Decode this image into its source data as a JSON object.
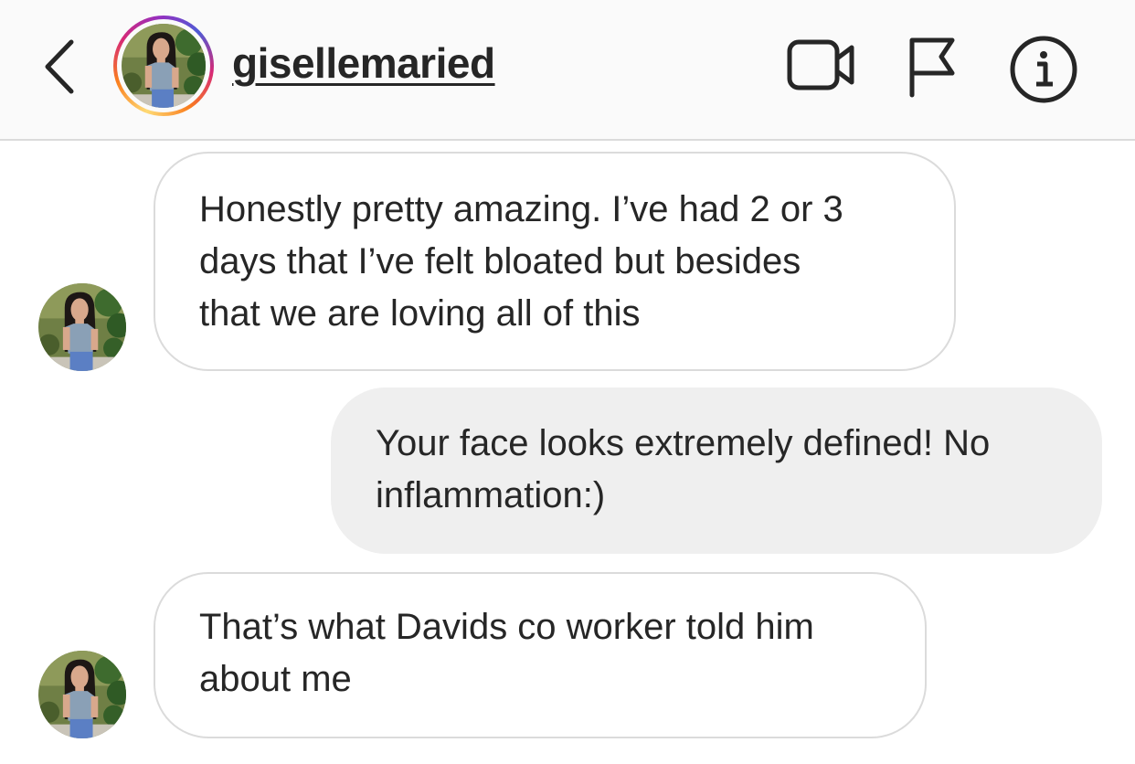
{
  "header": {
    "username": "gisellemaried",
    "icons": {
      "back": "chevron-left-icon",
      "video_call": "video-camera-icon",
      "report": "flag-icon",
      "info": "info-icon"
    }
  },
  "messages": [
    {
      "sender": "received",
      "lines": [
        "Honestly pretty amazing. I’ve had 2 or 3",
        "days that I’ve felt bloated but besides",
        "that we are loving all of this"
      ]
    },
    {
      "sender": "sent",
      "lines": [
        "Your face looks extremely defined! No",
        "inflammation:)"
      ]
    },
    {
      "sender": "received",
      "lines": [
        "That’s what Davids co worker told him",
        "about me"
      ]
    }
  ],
  "colors": {
    "header_bg": "#fafafa",
    "sent_bubble": "#efefef",
    "received_border": "#dbdbdb",
    "text": "#262626"
  }
}
